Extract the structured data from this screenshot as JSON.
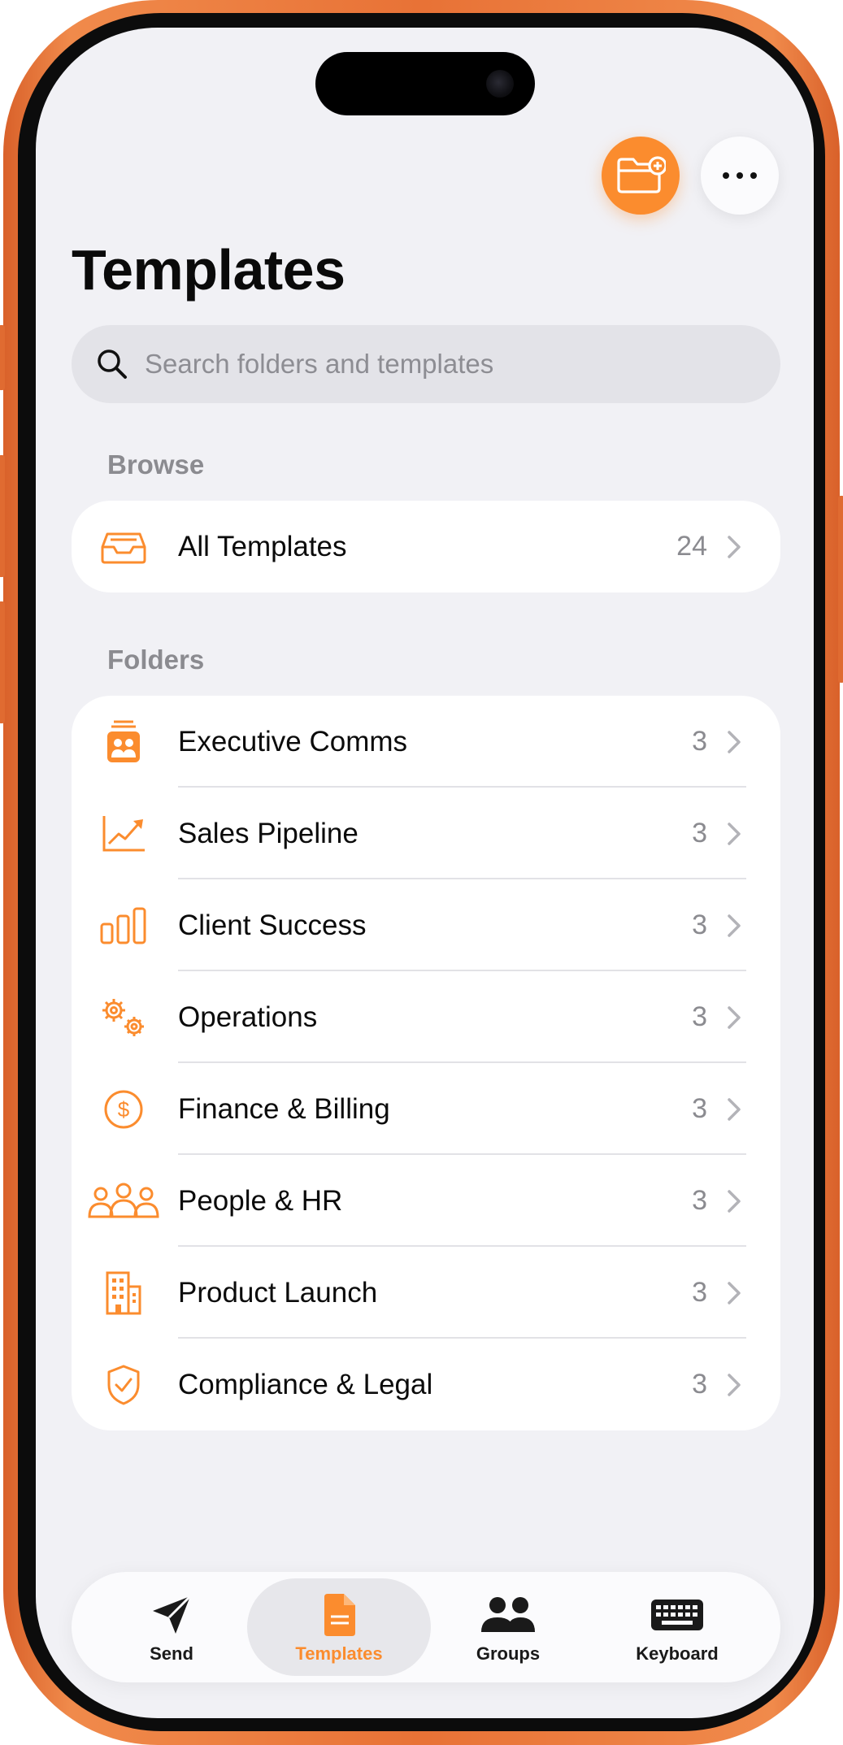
{
  "colors": {
    "accent": "#fb8c2e",
    "frame": "#e87236",
    "background": "#f1f1f5",
    "card": "#ffffff",
    "secondary_text": "#8b8b90"
  },
  "header": {
    "new_folder_icon": "folder-plus-icon",
    "more_icon": "ellipsis-icon",
    "title": "Templates"
  },
  "search": {
    "placeholder": "Search folders and templates",
    "icon": "magnifying-glass-icon"
  },
  "browse": {
    "section_label": "Browse",
    "items": [
      {
        "label": "All Templates",
        "count": "24",
        "icon": "tray-icon"
      }
    ]
  },
  "folders": {
    "section_label": "Folders",
    "items": [
      {
        "label": "Executive Comms",
        "count": "3",
        "icon": "executive-icon"
      },
      {
        "label": "Sales Pipeline",
        "count": "3",
        "icon": "chart-line-icon"
      },
      {
        "label": "Client Success",
        "count": "3",
        "icon": "bar-chart-icon"
      },
      {
        "label": "Operations",
        "count": "3",
        "icon": "gears-icon"
      },
      {
        "label": "Finance & Billing",
        "count": "3",
        "icon": "dollar-circle-icon"
      },
      {
        "label": "People & HR",
        "count": "3",
        "icon": "people-icon"
      },
      {
        "label": "Product Launch",
        "count": "3",
        "icon": "building-icon"
      },
      {
        "label": "Compliance & Legal",
        "count": "3",
        "icon": "shield-check-icon"
      }
    ]
  },
  "tabbar": {
    "active": "Templates",
    "tabs": [
      {
        "label": "Send",
        "icon": "paper-plane-icon"
      },
      {
        "label": "Templates",
        "icon": "document-icon"
      },
      {
        "label": "Groups",
        "icon": "two-people-icon"
      },
      {
        "label": "Keyboard",
        "icon": "keyboard-icon"
      }
    ]
  }
}
